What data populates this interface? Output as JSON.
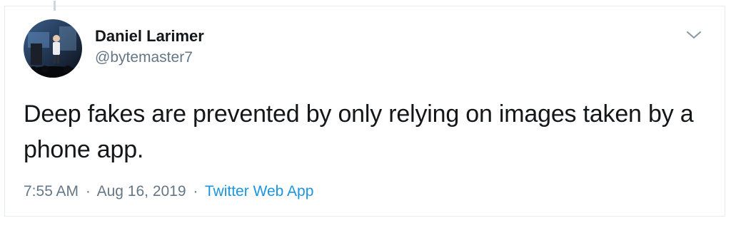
{
  "tweet": {
    "author": {
      "display_name": "Daniel Larimer",
      "handle": "@bytemaster7",
      "avatar_icon": "profile-photo"
    },
    "text": "Deep fakes are prevented by only relying on images taken by a phone app.",
    "time": "7:55 AM",
    "separator": "·",
    "date": "Aug 16, 2019",
    "source": "Twitter Web App",
    "menu_icon": "chevron-down-icon"
  },
  "colors": {
    "text_primary": "#14171a",
    "text_secondary": "#657786",
    "link": "#1b95e0",
    "border": "#e6ecf0"
  }
}
